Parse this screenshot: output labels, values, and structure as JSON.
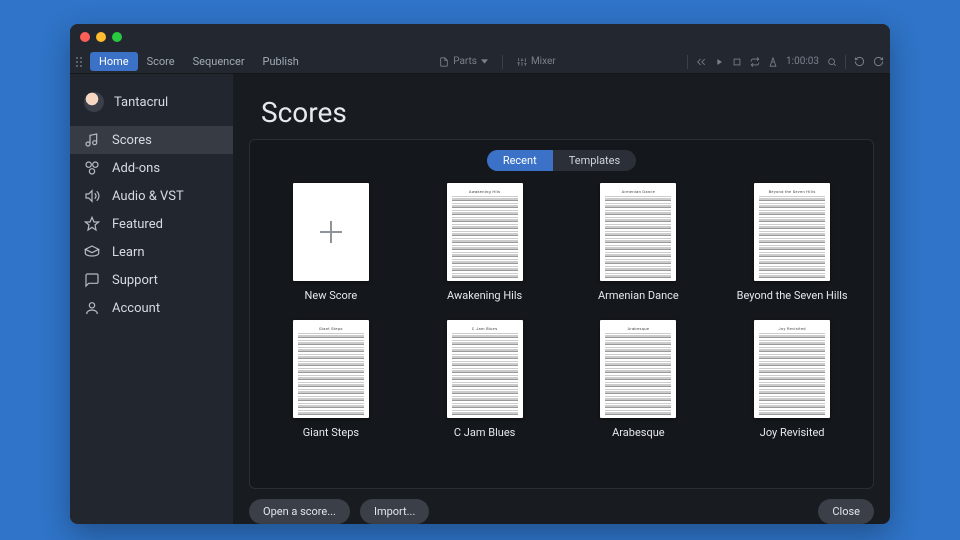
{
  "menubar": {
    "items": [
      "Home",
      "Score",
      "Sequencer",
      "Publish"
    ],
    "activeIndex": 0
  },
  "mid": {
    "parts": "Parts",
    "mixer": "Mixer"
  },
  "right": {
    "time": "1:00:03"
  },
  "user": {
    "name": "Tantacrul"
  },
  "sidebar": {
    "items": [
      {
        "icon": "music",
        "label": "Scores"
      },
      {
        "icon": "addon",
        "label": "Add-ons"
      },
      {
        "icon": "audio",
        "label": "Audio & VST"
      },
      {
        "icon": "star",
        "label": "Featured"
      },
      {
        "icon": "learn",
        "label": "Learn"
      },
      {
        "icon": "support",
        "label": "Support"
      },
      {
        "icon": "account",
        "label": "Account"
      }
    ],
    "activeIndex": 0
  },
  "main": {
    "title": "Scores",
    "tabs": [
      "Recent",
      "Templates"
    ],
    "activeTab": 0,
    "cards": [
      {
        "new": true,
        "label": "New Score"
      },
      {
        "label": "Awakening Hils"
      },
      {
        "label": "Armenian Dance"
      },
      {
        "label": "Beyond the Seven Hills"
      },
      {
        "label": "Giant Steps"
      },
      {
        "label": "C Jam Blues"
      },
      {
        "label": "Arabesque"
      },
      {
        "label": "Joy Revisited"
      }
    ]
  },
  "footer": {
    "open": "Open a score...",
    "import": "Import...",
    "close": "Close"
  }
}
